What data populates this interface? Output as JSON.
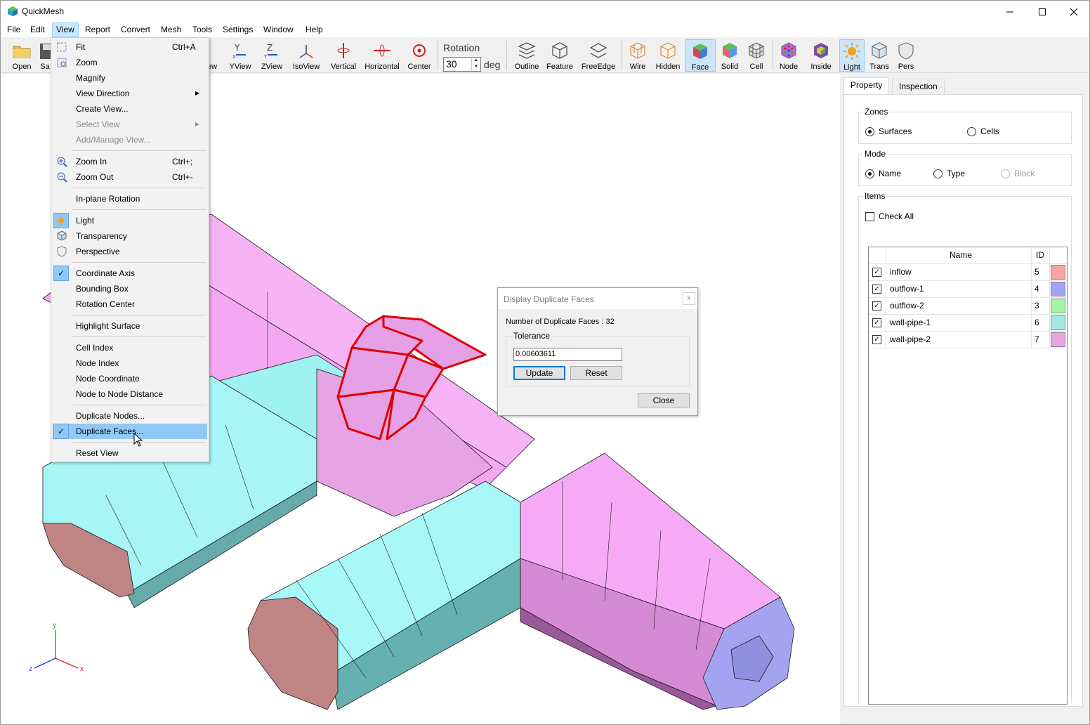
{
  "app": {
    "title": "QuickMesh",
    "colors": {
      "accent": "#0078d7",
      "selection": "#91c9f7",
      "duplicate_edges": "#e00000"
    }
  },
  "menubar": [
    "File",
    "Edit",
    "View",
    "Report",
    "Convert",
    "Mesh",
    "Tools",
    "Settings",
    "Window",
    "Help"
  ],
  "toolbar": {
    "open": "Open",
    "save": "Sa",
    "xview": "ew",
    "yview": "YView",
    "zview": "ZView",
    "isoview": "IsoView",
    "vertical": "Vertical",
    "horizontal": "Horizontal",
    "center": "Center",
    "rotation_label": "Rotation",
    "rotation_value": "30",
    "rotation_unit": "deg",
    "outline": "Outline",
    "feature": "Feature",
    "freeedge": "FreeEdge",
    "wire": "Wire",
    "hidden": "Hidden",
    "face": "Face",
    "solid": "Solid",
    "cell": "Cell",
    "node": "Node",
    "inside": "Inside",
    "light": "Light",
    "trans": "Trans",
    "pers": "Pers"
  },
  "view_menu": {
    "fit": "Fit",
    "fit_shortcut": "Ctrl+A",
    "zoom": "Zoom",
    "magnify": "Magnify",
    "view_direction": "View Direction",
    "create_view": "Create View...",
    "select_view": "Select View",
    "add_manage_view": "Add/Manage View...",
    "zoom_in": "Zoom In",
    "zoom_in_shortcut": "Ctrl+;",
    "zoom_out": "Zoom Out",
    "zoom_out_shortcut": "Ctrl+-",
    "inplane_rotation": "In-plane Rotation",
    "light": "Light",
    "transparency": "Transparency",
    "perspective": "Perspective",
    "coordinate_axis": "Coordinate Axis",
    "bounding_box": "Bounding Box",
    "rotation_center": "Rotation Center",
    "highlight_surface": "Highlight Surface",
    "cell_index": "Cell Index",
    "node_index": "Node Index",
    "node_coordinate": "Node Coordinate",
    "node_to_node": "Node to Node Distance",
    "duplicate_nodes": "Duplicate Nodes...",
    "duplicate_faces": "Duplicate Faces...",
    "reset_view": "Reset View"
  },
  "dialog": {
    "title": "Display Duplicate Faces",
    "close_x": "x",
    "count_text": "Number of Duplicate Faces : 32",
    "tolerance_label": "Tolerance",
    "tolerance_value": "0.00603611",
    "update": "Update",
    "reset": "Reset",
    "close": "Close"
  },
  "panel": {
    "tabs": [
      "Property",
      "Inspection"
    ],
    "zones_label": "Zones",
    "surfaces": "Surfaces",
    "cells": "Cells",
    "mode_label": "Mode",
    "name": "Name",
    "type": "Type",
    "block": "Block",
    "items_label": "Items",
    "check_all": "Check All",
    "col_name": "Name",
    "col_id": "ID",
    "items": [
      {
        "name": "inflow",
        "id": "5",
        "color": "#f5a3a3"
      },
      {
        "name": "outflow-1",
        "id": "4",
        "color": "#a3a3f5"
      },
      {
        "name": "outflow-2",
        "id": "3",
        "color": "#a3f5a3"
      },
      {
        "name": "wall-pipe-1",
        "id": "6",
        "color": "#a3e6e6"
      },
      {
        "name": "wall-pipe-2",
        "id": "7",
        "color": "#e6a3e6"
      }
    ]
  },
  "axes": {
    "y": "y",
    "z": "z",
    "x": "x"
  }
}
